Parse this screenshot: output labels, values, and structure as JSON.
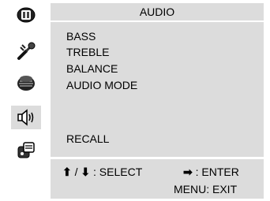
{
  "sidebar": {
    "icons": [
      {
        "name": "picture-icon"
      },
      {
        "name": "setup-wrench-icon"
      },
      {
        "name": "speaker-grille-icon"
      },
      {
        "name": "audio-speaker-icon",
        "selected": true
      },
      {
        "name": "function-icon"
      }
    ]
  },
  "menu": {
    "title": "AUDIO",
    "items": [
      "BASS",
      "TREBLE",
      "BALANCE",
      "AUDIO MODE",
      "RECALL"
    ]
  },
  "footer": {
    "up_arrow": "⬆",
    "separator": "/",
    "down_arrow": "⬇",
    "select": ": SELECT",
    "right_arrow": "➡",
    "enter": ": ENTER",
    "menu_exit": "MENU: EXIT"
  }
}
